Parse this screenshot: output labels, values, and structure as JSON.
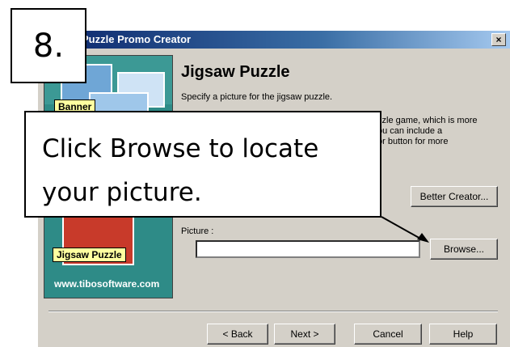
{
  "window": {
    "title": "Jigsaw Puzzle Promo Creator",
    "title_visible": "Puzzle Promo Creator",
    "close_glyph": "×"
  },
  "side_panel": {
    "tag_banner": "Banner",
    "tag_jigsaw": "Jigsaw Puzzle",
    "url": "www.tibosoftware.com"
  },
  "page": {
    "heading": "Jigsaw Puzzle",
    "subtitle": "Specify a picture for the jigsaw puzzle.",
    "desc_lines": [
      "zzle game, which is more",
      "ou can include a",
      "or button for more"
    ],
    "better_creator_label": "Better Creator...",
    "picture_label": "Picture :",
    "picture_value": "",
    "browse_label": "Browse..."
  },
  "footer": {
    "back_label": "< Back",
    "next_label": "Next >",
    "cancel_label": "Cancel",
    "help_label": "Help"
  },
  "annotation": {
    "step_number": "8.",
    "callout_line1": "Click Browse to locate",
    "callout_line2": "your picture."
  },
  "colors": {
    "dialog_bg": "#d4d0c8",
    "title_gradient_start": "#0a246a",
    "side_panel_teal": "#2e8b87"
  }
}
